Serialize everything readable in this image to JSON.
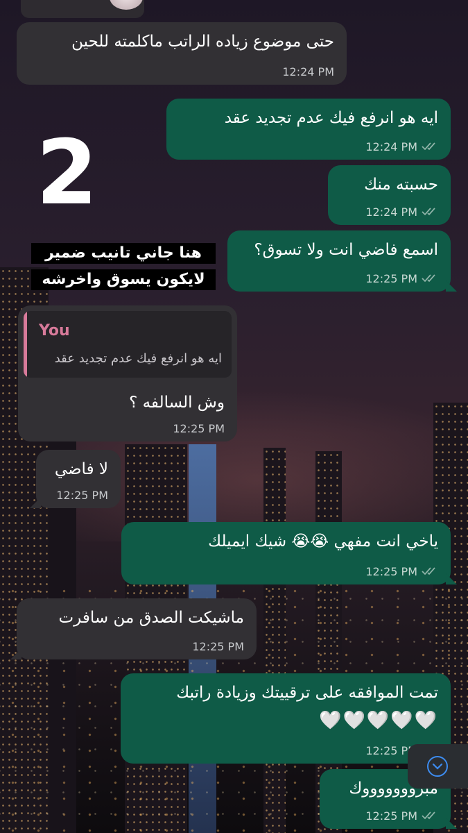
{
  "messages": [
    {
      "id": "m1",
      "dir": "in",
      "text": "حتى موضوع زياده الراتب ماكلمته للحين",
      "time": "12:24 PM"
    },
    {
      "id": "m2",
      "dir": "out",
      "text": "ايه هو انرفع فيك عدم تجديد عقد",
      "time": "12:24 PM"
    },
    {
      "id": "m3",
      "dir": "out",
      "text": "حسبته منك",
      "time": "12:24 PM"
    },
    {
      "id": "m4",
      "dir": "out",
      "text": "اسمع فاضي انت ولا تسوق؟",
      "time": "12:25 PM"
    },
    {
      "id": "m5",
      "dir": "in",
      "quote_author": "You",
      "quote_text": "ايه هو انرفع فيك عدم تجديد عقد",
      "text": "وش السالفه ؟",
      "time": "12:25 PM"
    },
    {
      "id": "m6",
      "dir": "in",
      "text": "لا فاضي",
      "time": "12:25 PM"
    },
    {
      "id": "m7",
      "dir": "out",
      "text": "ياخي انت مفهي 😭😭 شيك ايميلك",
      "time": "12:25 PM"
    },
    {
      "id": "m8",
      "dir": "in",
      "text": "ماشيكت الصدق من سافرت",
      "time": "12:25 PM"
    },
    {
      "id": "m9",
      "dir": "out",
      "text_line1": "تمت الموافقه على ترقييتك وزيادة راتبك",
      "text_line2": "🤍🤍🤍🤍🤍",
      "time": "12:25 PM"
    },
    {
      "id": "m10",
      "dir": "out",
      "text": "مبروووووووك",
      "time": "12:25 PM"
    }
  ],
  "overlay": {
    "number": "2",
    "caption_line1": "هنا جاني تانيب ضمير",
    "caption_line2": "لايكون يسوق واخرشه"
  },
  "colors": {
    "incoming": "#323034",
    "outgoing": "#0f5b47",
    "read_ticks": "#c7d8d2",
    "quote_accent": "#d77a9a"
  },
  "icons": {
    "read_status": "double-check-icon",
    "scroll_down": "chevron-down-icon"
  }
}
